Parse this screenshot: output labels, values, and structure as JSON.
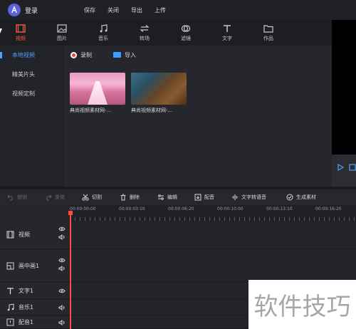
{
  "titlebar": {
    "login": "登录",
    "menu": [
      "保存",
      "关闭",
      "导出",
      "上传"
    ]
  },
  "tabs": [
    {
      "label": "视频",
      "icon": "film-icon",
      "active": true
    },
    {
      "label": "图片",
      "icon": "image-icon",
      "active": false
    },
    {
      "label": "音乐",
      "icon": "music-icon",
      "active": false
    },
    {
      "label": "转场",
      "icon": "transition-icon",
      "active": false
    },
    {
      "label": "滤镜",
      "icon": "filter-icon",
      "active": false
    },
    {
      "label": "文字",
      "icon": "text-icon",
      "active": false
    },
    {
      "label": "作品",
      "icon": "folder-icon",
      "active": false
    }
  ],
  "sidebar": {
    "items": [
      {
        "label": "本地视频",
        "active": true
      },
      {
        "label": "精美片头",
        "active": false
      },
      {
        "label": "视频定制",
        "active": false
      }
    ]
  },
  "actions": {
    "record": "录制",
    "import": "导入"
  },
  "thumbs": [
    {
      "caption": "典尚视频素材网-..."
    },
    {
      "caption": "典尚视频素材网-..."
    }
  ],
  "edit_toolbar": {
    "undo": "撤销",
    "redo": "重做",
    "cut": "切割",
    "delete": "删除",
    "edit": "编辑",
    "dub": "配音",
    "tts": "文字转语音",
    "generate": "生成素材"
  },
  "ruler": [
    "00:00:00:00",
    "00:00:03:10",
    "00:00:06:20",
    "00:00:10:00",
    "00:00:13:10",
    "00:00:16:20"
  ],
  "tracks": [
    {
      "name": "视频"
    },
    {
      "name": "画中画1"
    },
    {
      "name": "文字1"
    },
    {
      "name": "音乐1"
    },
    {
      "name": "配音1"
    }
  ],
  "watermark": "软件技巧",
  "colors": {
    "accent_red": "#ff5c4a",
    "accent_blue": "#4da3ff",
    "playhead": "#ff4b3a"
  }
}
